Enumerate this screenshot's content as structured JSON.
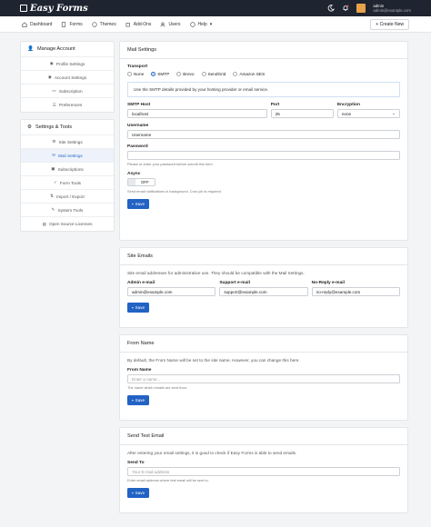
{
  "app": {
    "name": "Easy Forms"
  },
  "user": {
    "name": "admin",
    "email": "admin@example.com"
  },
  "nav": {
    "items": [
      {
        "label": "Dashboard",
        "icon": "home-icon"
      },
      {
        "label": "Forms",
        "icon": "file-icon"
      },
      {
        "label": "Themes",
        "icon": "palette-icon"
      },
      {
        "label": "Add-Ons",
        "icon": "puzzle-icon"
      },
      {
        "label": "Users",
        "icon": "users-icon"
      },
      {
        "label": "Help",
        "icon": "help-icon"
      }
    ],
    "create_label": "+ Create New"
  },
  "sidebar": {
    "account": {
      "title": "Manage Account",
      "items": [
        {
          "label": "Profile Settings"
        },
        {
          "label": "Account Settings"
        },
        {
          "label": "Subscription"
        },
        {
          "label": "Preferences"
        }
      ]
    },
    "settings": {
      "title": "Settings & Tools",
      "items": [
        {
          "label": "Site Settings"
        },
        {
          "label": "Mail Settings"
        },
        {
          "label": "Subscriptions"
        },
        {
          "label": "Form Tools"
        },
        {
          "label": "Import / Export"
        },
        {
          "label": "System Tools"
        },
        {
          "label": "Open Source Licenses"
        }
      ]
    }
  },
  "mail": {
    "title": "Mail Settings",
    "transport_label": "Transport",
    "transports": [
      "None",
      "SMTP",
      "Brevo",
      "SendGrid",
      "Amazon SES"
    ],
    "selected_transport": "SMTP",
    "info": "Use the SMTP details provided by your hosting provider or email service.",
    "host_label": "SMTP Host",
    "host_value": "localhost",
    "port_label": "Port",
    "port_value": "25",
    "encryption_label": "Encryption",
    "encryption_value": "none",
    "username_label": "Username",
    "username_value": "Username",
    "password_label": "Password",
    "password_help": "Please re-enter your password before submit this form.",
    "async_label": "Async",
    "async_value": "OFF",
    "async_help": "Send email notifications in background. Cron job is required.",
    "save_label": "Save"
  },
  "site_emails": {
    "title": "Site Emails",
    "desc": "Site email addresses for administrative use. They should be compatible with the Mail Settings.",
    "admin_label": "Admin e-mail",
    "admin_value": "admin@example.com",
    "support_label": "Support e-mail",
    "support_value": "support@example.com",
    "noreply_label": "No-Reply e-mail",
    "noreply_value": "no-reply@example.com",
    "save_label": "Save"
  },
  "from_name": {
    "title": "From Name",
    "desc": "By default, the From Name will be set to the site name. However, you can change this here.",
    "label": "From Name",
    "placeholder": "Enter a name...",
    "help": "The name which emails are sent from.",
    "save_label": "Save"
  },
  "test_email": {
    "title": "Send Test Email",
    "desc": "After entering your email settings, it is good to check if Easy Forms is able to send emails.",
    "label": "Send To",
    "placeholder": "Your E-mail address",
    "help": "Enter email address where test email will be sent to.",
    "save_label": "Save"
  },
  "colors": {
    "primary": "#2262c4",
    "topbar": "#1e2530"
  }
}
